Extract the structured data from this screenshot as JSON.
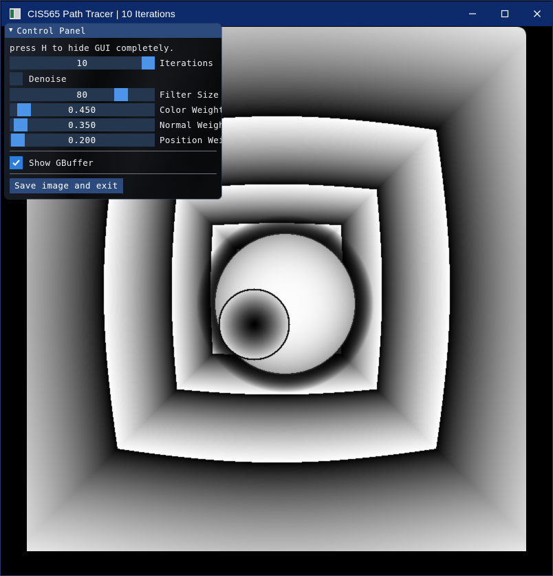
{
  "window": {
    "title": "CIS565 Path Tracer | 10 Iterations",
    "icon": "app-icon",
    "controls": {
      "minimize": "minimize-icon",
      "maximize": "maximize-icon",
      "close": "close-icon"
    }
  },
  "control_panel": {
    "arrow": "▼",
    "title": "Control Panel",
    "hint": "press H to hide GUI completely.",
    "sliders": [
      {
        "value": "10",
        "label": "Iterations",
        "handle_pct": 91
      },
      {
        "value": "80",
        "label": "Filter Size",
        "handle_pct": 72
      },
      {
        "value": "0.450",
        "label": "Color Weight",
        "handle_pct": 5
      },
      {
        "value": "0.350",
        "label": "Normal Weight",
        "handle_pct": 3
      },
      {
        "value": "0.200",
        "label": "Position Weigh",
        "handle_pct": 1
      }
    ],
    "checkboxes": [
      {
        "label": "Denoise",
        "checked": false
      },
      {
        "label": "Show GBuffer",
        "checked": true
      }
    ],
    "save_button": "Save image and exit"
  },
  "render": {
    "description": "gbuffer-position-visualization",
    "background": "#000000"
  },
  "colors": {
    "titlebar": "#0d2b6b",
    "panel_header": "#2c4a7c",
    "slider_track": "#25364f",
    "slider_handle": "#4b94e8",
    "checkbox_checked": "#2b7fdb",
    "panel_body": "#111316",
    "window_border": "#2a3a66"
  }
}
